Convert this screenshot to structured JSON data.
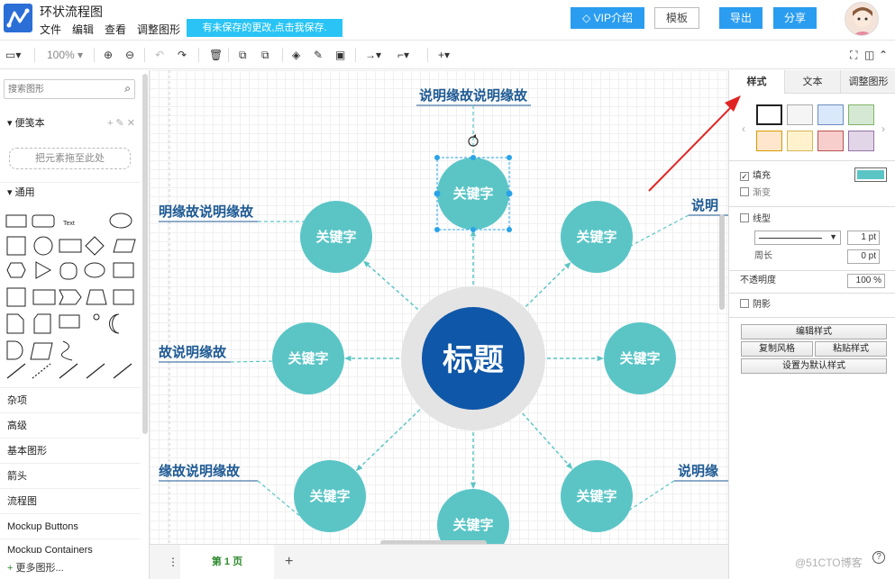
{
  "app": {
    "title": "环状流程图",
    "save_notice": "有未保存的更改,点击我保存."
  },
  "menu": [
    "文件",
    "编辑",
    "查看",
    "调整图形"
  ],
  "header_buttons": {
    "vip": "VIP介绍",
    "template": "模板",
    "export": "导出",
    "share": "分享"
  },
  "toolbar": {
    "zoom": "100%"
  },
  "sidebar": {
    "search_placeholder": "搜索图形",
    "scratchpad": "便笺本",
    "scratch_drop": "把元素拖至此处",
    "general": "通用",
    "categories": [
      "杂项",
      "高级",
      "基本图形",
      "箭头",
      "流程图",
      "Mockup Buttons",
      "Mockup Containers"
    ],
    "more_shapes": "更多图形..."
  },
  "diagram": {
    "center_label": "标题",
    "node_label": "关键字",
    "desc_top": "说明缘故说明缘故",
    "desc_left_top": "明缘故说明缘故",
    "desc_left_mid": "故说明缘故",
    "desc_left_bottom": "缘故说明缘故",
    "desc_right_top": "说明",
    "desc_right_bottom": "说明缘",
    "colors": {
      "node": "#5bc5c6",
      "center": "#0f57a8",
      "ring": "#e4e4e4",
      "desc": "#1e5a94",
      "connector": "#5bc5c6"
    }
  },
  "pages": {
    "current": "第 1 页"
  },
  "format_panel": {
    "tabs": [
      "样式",
      "文本",
      "调整图形"
    ],
    "fill": "填充",
    "gradient": "渐变",
    "line": "线型",
    "line_width": "1 pt",
    "perimeter": "周长",
    "perimeter_value": "0 pt",
    "opacity": "不透明度",
    "opacity_value": "100 %",
    "shadow": "阴影",
    "edit_style": "编辑样式",
    "copy_style": "复制风格",
    "paste_style": "粘贴样式",
    "set_default": "设置为默认样式",
    "fill_color": "#5bc5c6"
  },
  "watermark": "@51CTO博客"
}
